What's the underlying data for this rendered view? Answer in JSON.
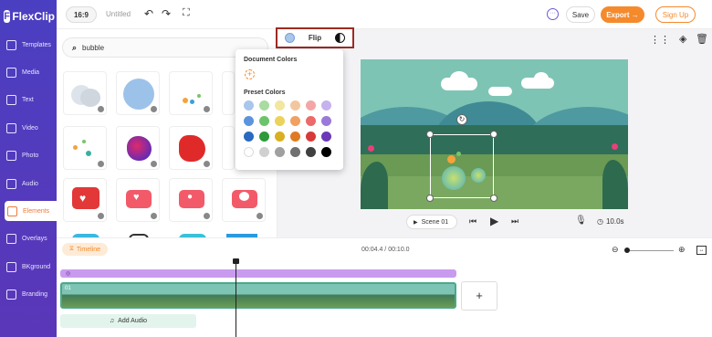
{
  "brand": {
    "name": "FlexClip",
    "accent": "#f58a2c",
    "sidebar_color": "#4b3fc1"
  },
  "sidebar": {
    "items": [
      {
        "label": "Templates",
        "icon": "templates-icon"
      },
      {
        "label": "Media",
        "icon": "media-icon"
      },
      {
        "label": "Text",
        "icon": "text-icon"
      },
      {
        "label": "Video",
        "icon": "video-icon"
      },
      {
        "label": "Photo",
        "icon": "photo-icon"
      },
      {
        "label": "Audio",
        "icon": "audio-icon"
      },
      {
        "label": "Elements",
        "icon": "elements-icon",
        "active": true
      },
      {
        "label": "Overlays",
        "icon": "overlays-icon"
      },
      {
        "label": "BKground",
        "icon": "background-icon"
      },
      {
        "label": "Branding",
        "icon": "branding-icon"
      }
    ]
  },
  "topbar": {
    "ratio": "16:9",
    "project_name": "Untitled",
    "save_label": "Save",
    "export_label": "Export →",
    "signup_label": "Sign Up"
  },
  "search": {
    "value": "bubble"
  },
  "toolbar": {
    "flip_label": "Flip"
  },
  "color_popover": {
    "document_title": "Document Colors",
    "preset_title": "Preset Colors",
    "preset_colors": [
      "#a9c6ec",
      "#a8dca0",
      "#f2e6a0",
      "#f4c6a0",
      "#f4a6a6",
      "#c6b2ec",
      "#5b94dc",
      "#6cc46a",
      "#ecd25a",
      "#f0a060",
      "#ec6a6a",
      "#9a7ad8",
      "#2a6ac0",
      "#2e9a38",
      "#d8b020",
      "#e07a22",
      "#d83a3a",
      "#6a3ab8",
      "#ffffff",
      "#d0d0d0",
      "#a0a0a0",
      "#707070",
      "#404040",
      "#000000"
    ]
  },
  "preview": {
    "scene_label": "Scene 01",
    "duration": "10.0s"
  },
  "timeline": {
    "tab_label": "Timeline",
    "time_display": "00:04.4 / 00:10.0",
    "clip_label": "01",
    "add_audio_label": "Add Audio"
  }
}
